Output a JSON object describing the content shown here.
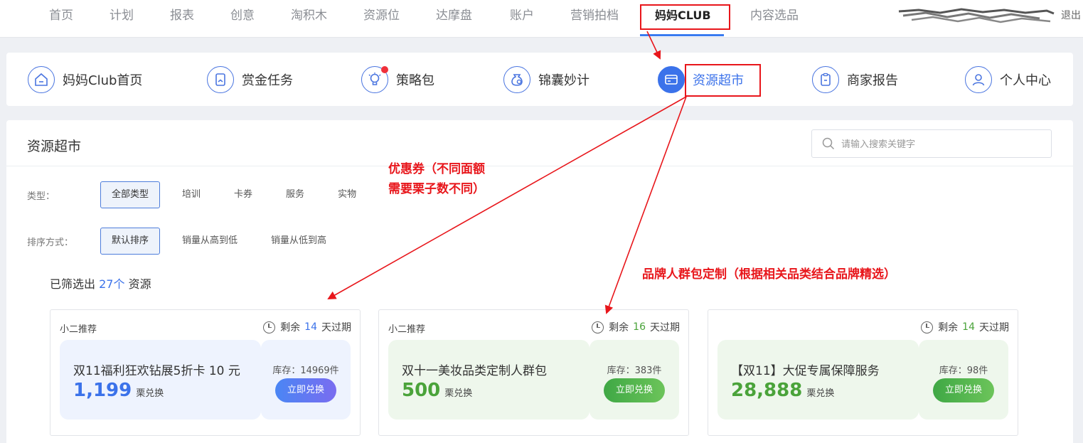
{
  "top_nav": {
    "items": [
      "首页",
      "计划",
      "报表",
      "创意",
      "淘积木",
      "资源位",
      "达摩盘",
      "账户",
      "营销拍档",
      "妈妈CLUB",
      "内容选品"
    ],
    "active": "妈妈CLUB",
    "logout": "退出"
  },
  "club_nav": {
    "items": [
      {
        "label": "妈妈Club首页",
        "icon": "home-icon"
      },
      {
        "label": "赏金任务",
        "icon": "bookmark-icon"
      },
      {
        "label": "策略包",
        "icon": "bulb-icon",
        "badge": true
      },
      {
        "label": "锦囊妙计",
        "icon": "pouch-icon"
      },
      {
        "label": "资源超市",
        "icon": "card-icon",
        "active": true
      },
      {
        "label": "商家报告",
        "icon": "report-icon"
      },
      {
        "label": "个人中心",
        "icon": "user-icon"
      }
    ]
  },
  "panel": {
    "title": "资源超市",
    "search_placeholder": "请输入搜索关键字",
    "type_label": "类型：",
    "type_options": [
      "全部类型",
      "培训",
      "卡券",
      "服务",
      "实物"
    ],
    "type_selected": "全部类型",
    "sort_label": "排序方式：",
    "sort_options": [
      "默认排序",
      "销量从高到低",
      "销量从低到高"
    ],
    "sort_selected": "默认排序",
    "count_prefix": "已筛选出",
    "count_value": "27个",
    "count_suffix": "资源"
  },
  "cards": [
    {
      "recommend": "小二推荐",
      "expire_prefix": "剩余",
      "days": "14",
      "expire_suffix": "天过期",
      "name": "双11福利狂欢钻展5折卡 10 元",
      "price": "1,199",
      "price_unit": "栗兑换",
      "stock": "库存：14969件",
      "button": "立即兑换",
      "theme": "blue"
    },
    {
      "recommend": "小二推荐",
      "expire_prefix": "剩余",
      "days": "16",
      "expire_suffix": "天过期",
      "name": "双十一美妆品类定制人群包",
      "price": "500",
      "price_unit": "栗兑换",
      "stock": "库存：383件",
      "button": "立即兑换",
      "theme": "green"
    },
    {
      "recommend": "",
      "expire_prefix": "剩余",
      "days": "14",
      "expire_suffix": "天过期",
      "name": "【双11】大促专属保障服务",
      "price": "28,888",
      "price_unit": "栗兑换",
      "stock": "库存：98件",
      "button": "立即兑换",
      "theme": "green"
    }
  ],
  "annotations": {
    "coupon_line1": "优惠券（不同面额",
    "coupon_line2": "需要栗子数不同）",
    "brand": "品牌人群包定制（根据相关品类结合品牌精选）",
    "color": "#e8161b"
  }
}
